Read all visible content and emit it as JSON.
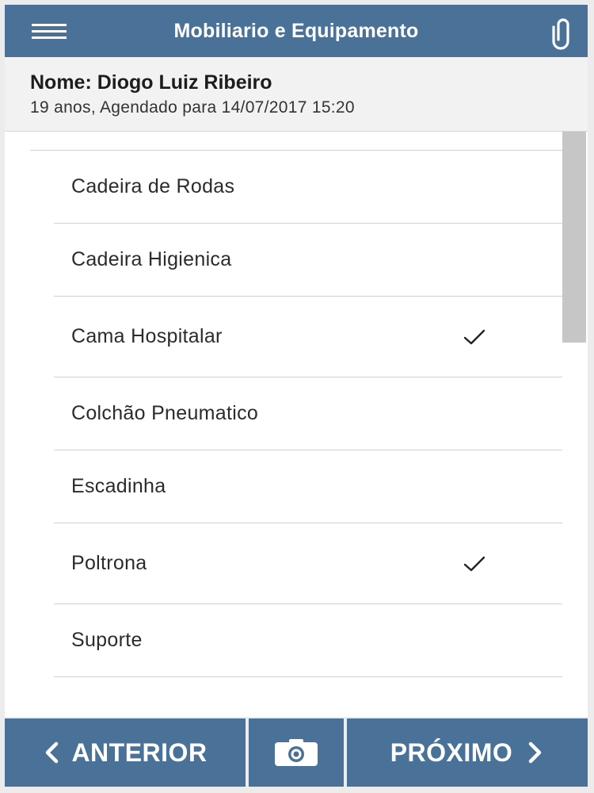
{
  "header": {
    "title": "Mobiliario e Equipamento",
    "menu_icon": "hamburger-menu-icon",
    "attach_icon": "paperclip-icon",
    "background_color": "#4a7299"
  },
  "patient": {
    "name": "Nome: Diogo Luiz Ribeiro",
    "info": "19 anos, Agendado para 14/07/2017 15:20"
  },
  "list": {
    "items": [
      {
        "label": "Cadeira de Rodas",
        "checked": false
      },
      {
        "label": "Cadeira Higienica",
        "checked": false
      },
      {
        "label": "Cama Hospitalar",
        "checked": true
      },
      {
        "label": "Colchão Pneumatico",
        "checked": false
      },
      {
        "label": "Escadinha",
        "checked": false
      },
      {
        "label": "Poltrona",
        "checked": true
      },
      {
        "label": "Suporte",
        "checked": false
      }
    ],
    "check_icon": "checkmark-icon"
  },
  "footer": {
    "prev_label": "ANTERIOR",
    "next_label": "PRÓXIMO",
    "camera_icon": "camera-icon",
    "button_color": "#4a7299"
  }
}
